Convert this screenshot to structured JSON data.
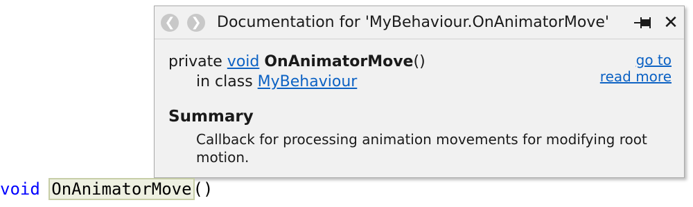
{
  "code": {
    "keyword": "void",
    "method_name": "OnAnimatorMove",
    "parens": "()"
  },
  "popup": {
    "title": "Documentation for 'MyBehaviour.OnAnimatorMove'",
    "nav": {
      "back_icon": "arrow-left-icon",
      "forward_icon": "arrow-right-icon"
    },
    "pin_icon": "pin-icon",
    "close_label": "✕",
    "signature": {
      "modifier": "private",
      "return_type": "void",
      "member_name": "OnAnimatorMove",
      "parens": "()"
    },
    "class_line": {
      "prefix": "in class",
      "class_name": "MyBehaviour"
    },
    "links": {
      "go_to": "go to",
      "read_more": "read more"
    },
    "summary": {
      "heading": "Summary",
      "text": "Callback for processing animation movements for modifying root motion."
    }
  },
  "colors": {
    "link": "#0c62c4",
    "keyword": "#0000ff",
    "popup_bg": "#f1f1f1",
    "highlight_bg": "#eef0e1"
  }
}
